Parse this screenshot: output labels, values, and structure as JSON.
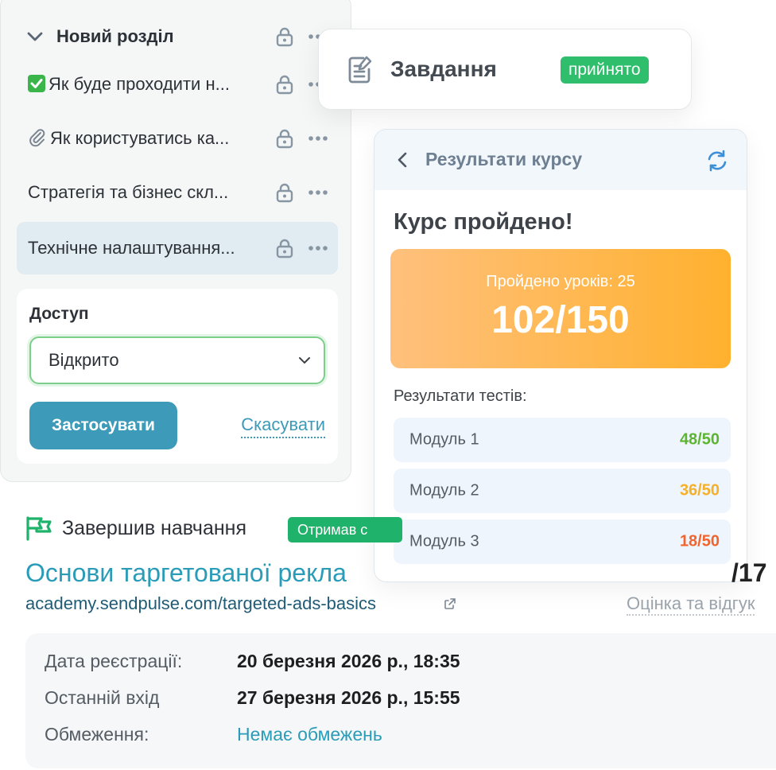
{
  "section": {
    "title": "Новий розділ",
    "lessons": [
      {
        "label": "Як буде проходити н...",
        "prefix": "check"
      },
      {
        "label": "Як користуватись ка...",
        "prefix": "paperclip"
      },
      {
        "label": "Стратегія та бізнес скл...",
        "prefix": ""
      },
      {
        "label": "Технічне налаштування...",
        "prefix": "",
        "selected": true
      }
    ]
  },
  "access": {
    "title": "Доступ",
    "selected": "Відкрито",
    "apply": "Застосувати",
    "cancel": "Скасувати"
  },
  "task": {
    "title": "Завдання",
    "status": "прийнято"
  },
  "results": {
    "header": "Результати курсу",
    "headline": "Курс пройдено!",
    "lessons_passed": "Пройдено уроків: 25",
    "score": "102/150",
    "tests_label": "Результати тестів:",
    "modules": [
      {
        "name": "Модуль 1",
        "score": "48/50",
        "color": "#5cb531"
      },
      {
        "name": "Модуль 2",
        "score": "36/50",
        "color": "#f5b02a"
      },
      {
        "name": "Модуль 3",
        "score": "18/50",
        "color": "#f0642d"
      }
    ]
  },
  "completion": {
    "text": "Завершив навчання",
    "badge": "Отримав с",
    "course_title": "Основи таргетованої рекла",
    "trailing": "/17",
    "url": "academy.sendpulse.com/targeted-ads-basics",
    "review": "Оцінка та відгук"
  },
  "info": [
    {
      "label": "Дата реєстрації:",
      "value": "20 березня 2026 р., 18:35",
      "link": false
    },
    {
      "label": "Останній вхід",
      "value": "27 березня 2026 р., 15:55",
      "link": false
    },
    {
      "label": "Обмеження:",
      "value": "Немає обмежень",
      "link": true
    }
  ],
  "colors": {
    "accent": "#3d9ab8",
    "success": "#2fbf6c",
    "link": "#2a9cb8"
  },
  "icons": [
    "chevron-down-icon",
    "lock-icon",
    "more-icon",
    "check-icon",
    "paperclip-icon",
    "task-icon",
    "back-icon",
    "refresh-icon",
    "flag-icon",
    "external-link-icon"
  ]
}
